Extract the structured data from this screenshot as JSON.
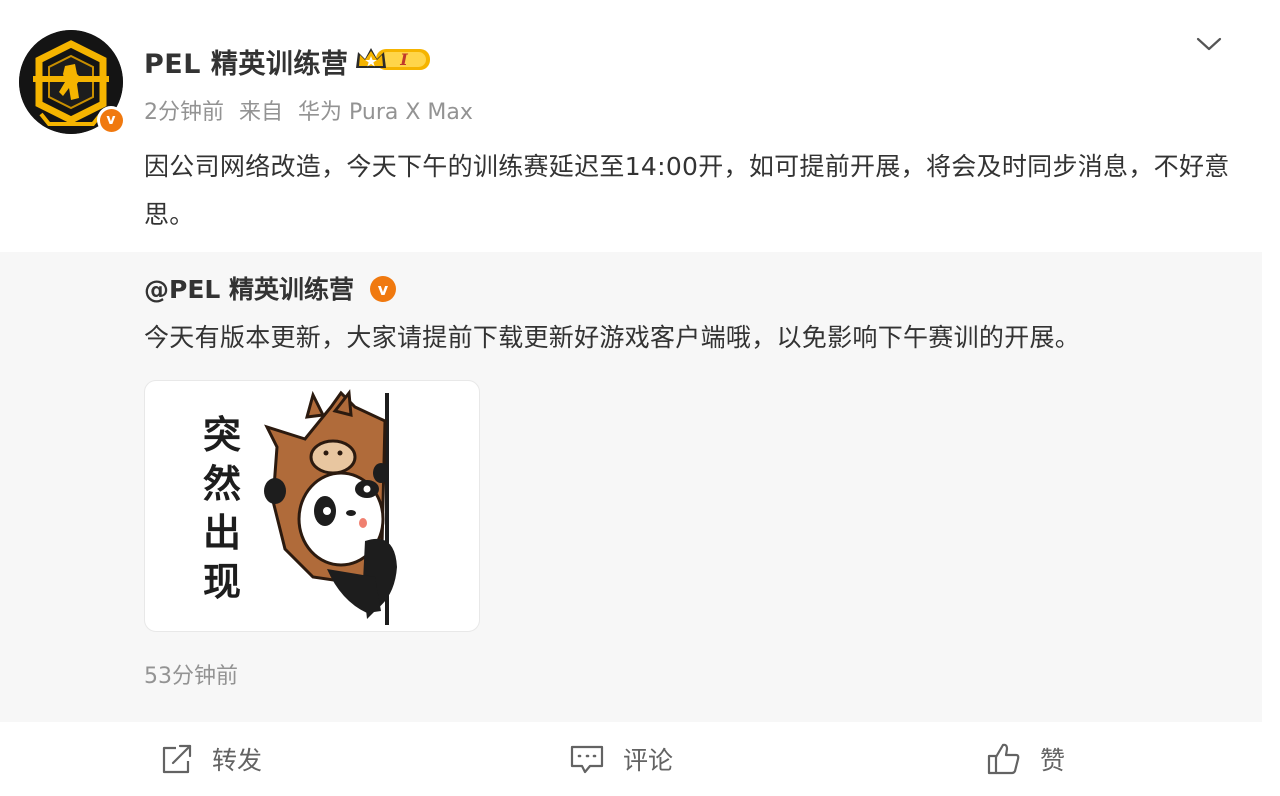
{
  "post": {
    "author": "PEL 精英训练营",
    "vip_level": "I",
    "verified_mark": "v",
    "time": "2分钟前",
    "source_prefix": "来自",
    "source": "华为 Pura X Max",
    "text": "因公司网络改造，今天下午的训练赛延迟至14:00开，如可提前开展，将会及时同步消息，不好意思。"
  },
  "quoted": {
    "author": "@PEL 精英训练营",
    "verified_mark": "v",
    "text": "今天有版本更新，大家请提前下载更新好游戏客户端哦，以免影响下午赛训的开展。",
    "image": {
      "sticker_text": "突然出现",
      "icon": "panda-in-horse-costume-sticker"
    },
    "time": "53分钟前"
  },
  "actions": {
    "forward_label": "转发",
    "comment_label": "评论",
    "like_label": "赞"
  },
  "colors": {
    "accent_orange": "#f0790f",
    "text_primary": "#333333",
    "text_secondary": "#939393",
    "quote_background": "#f7f7f7",
    "vip_gold": "#f5b400"
  },
  "icons": {
    "more": "chevron-down-icon",
    "forward": "share-icon",
    "comment": "comment-icon",
    "like": "thumbs-up-icon"
  }
}
